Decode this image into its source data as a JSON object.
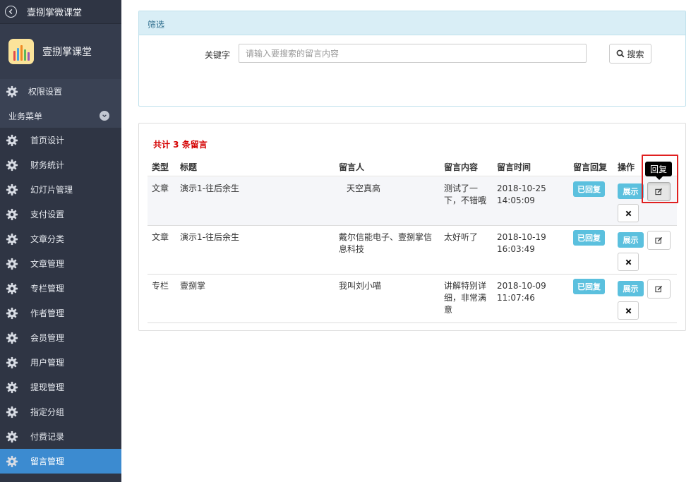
{
  "sidebar": {
    "top_title": "壹捌掌微课堂",
    "brand_name": "壹捌掌课堂",
    "permission_label": "权限设置",
    "group_label": "业务菜单",
    "items": [
      "首页设计",
      "财务统计",
      "幻灯片管理",
      "支付设置",
      "文章分类",
      "文章管理",
      "专栏管理",
      "作者管理",
      "会员管理",
      "用户管理",
      "提现管理",
      "指定分组",
      "付费记录",
      "留言管理"
    ],
    "active_item": "留言管理"
  },
  "filter": {
    "title": "筛选",
    "keyword_label": "关键字",
    "keyword_placeholder": "请输入要搜索的留言内容",
    "keyword_value": "",
    "search_label": "搜索"
  },
  "list": {
    "total_text": "共计 3 条留言",
    "headers": {
      "type": "类型",
      "title": "标题",
      "author": "留言人",
      "content": "留言内容",
      "time": "留言时间",
      "reply": "留言回复",
      "actions": "操作"
    },
    "rows": [
      {
        "type": "文章",
        "title": "演示1-往后余生",
        "author": "天空真高",
        "content": "测试了一下，不错哦",
        "date": "2018-10-25",
        "time": "14:05:09",
        "reply_status": "已回复",
        "show_label": "展示"
      },
      {
        "type": "文章",
        "title": "演示1-往后余生",
        "author": "戴尔信能电子、壹捌掌信息科技",
        "content": "太好听了",
        "date": "2018-10-19",
        "time": "16:03:49",
        "reply_status": "已回复",
        "show_label": "展示"
      },
      {
        "type": "专栏",
        "title": "壹捌掌",
        "author": "我叫刘小喵",
        "content": "讲解特别详细，非常满意",
        "date": "2018-10-09",
        "time": "11:07:46",
        "reply_status": "已回复",
        "show_label": "展示"
      }
    ]
  },
  "tooltip": {
    "text": "回复"
  },
  "colors": {
    "sidebar_bg": "#2f3544",
    "active": "#3c8bd0",
    "info": "#5bc0de",
    "total_text": "#d40000",
    "highlight_box": "#e02020"
  }
}
